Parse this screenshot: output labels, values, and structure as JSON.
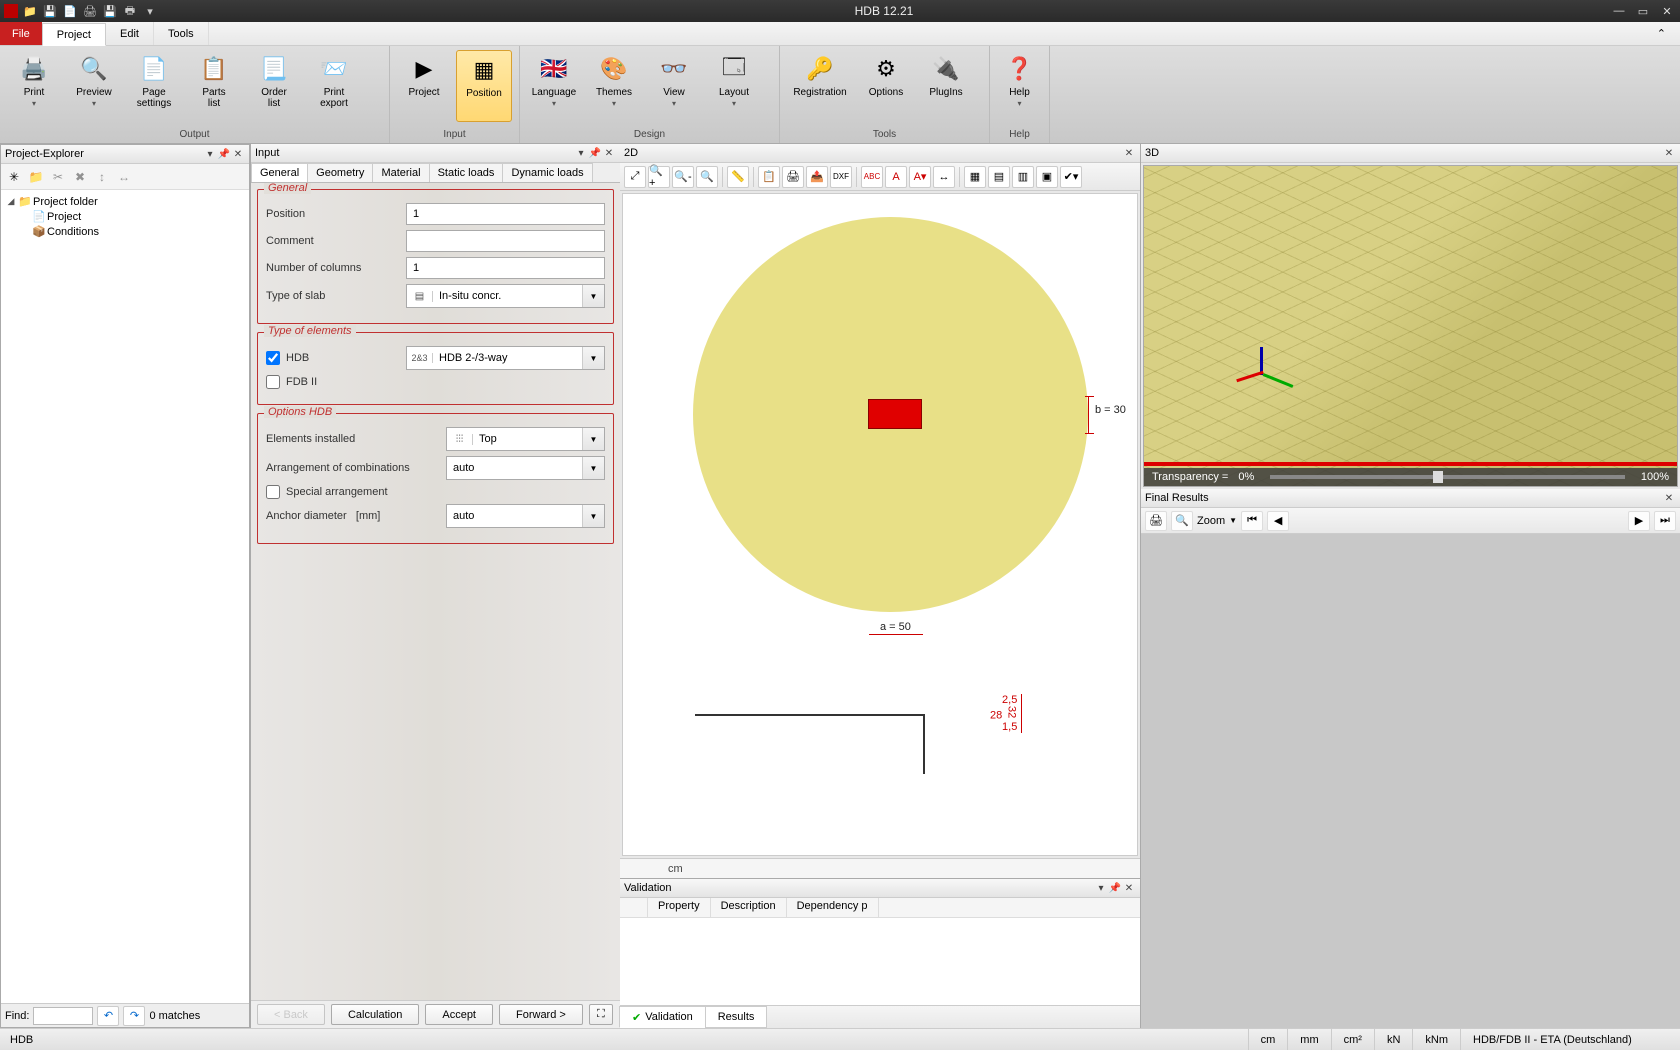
{
  "title": "HDB 12.21",
  "menubar": {
    "file": "File",
    "tabs": [
      "Project",
      "Edit",
      "Tools"
    ],
    "active": 0
  },
  "ribbon": {
    "groups": [
      {
        "caption": "Output",
        "items": [
          {
            "label": "Print",
            "icon": "🖨️",
            "drop": true
          },
          {
            "label": "Preview",
            "icon": "🔍",
            "drop": true
          },
          {
            "label": "Page\nsettings",
            "icon": "📄"
          },
          {
            "label": "Parts\nlist",
            "icon": "📋"
          },
          {
            "label": "Order\nlist",
            "icon": "📃"
          },
          {
            "label": "Print\nexport",
            "icon": "📨"
          }
        ]
      },
      {
        "caption": "Input",
        "items": [
          {
            "label": "Project",
            "icon": "▶"
          },
          {
            "label": "Position",
            "icon": "▦",
            "active": true
          }
        ]
      },
      {
        "caption": "Design",
        "items": [
          {
            "label": "Language",
            "icon": "🇬🇧",
            "drop": true
          },
          {
            "label": "Themes",
            "icon": "🎨",
            "drop": true
          },
          {
            "label": "View",
            "icon": "👓",
            "drop": true
          },
          {
            "label": "Layout",
            "icon": "🗔",
            "drop": true
          }
        ]
      },
      {
        "caption": "Tools",
        "items": [
          {
            "label": "Registration",
            "icon": "🔑"
          },
          {
            "label": "Options",
            "icon": "⚙"
          },
          {
            "label": "PlugIns",
            "icon": "🔌"
          }
        ]
      },
      {
        "caption": "Help",
        "items": [
          {
            "label": "Help",
            "icon": "❓",
            "drop": true
          }
        ]
      }
    ]
  },
  "projectExplorer": {
    "title": "Project-Explorer",
    "root": "Project folder",
    "children": [
      {
        "label": "Project",
        "icon": "📄"
      },
      {
        "label": "Conditions",
        "icon": "📦"
      }
    ]
  },
  "find": {
    "label": "Find:",
    "matches": "0 matches"
  },
  "inputPanel": {
    "title": "Input",
    "tabs": [
      "General",
      "Geometry",
      "Material",
      "Static loads",
      "Dynamic loads"
    ],
    "activeTab": 0,
    "general": {
      "legend": "General",
      "position_lbl": "Position",
      "position": "1",
      "comment_lbl": "Comment",
      "comment": "",
      "numcols_lbl": "Number of columns",
      "numcols": "1",
      "slab_lbl": "Type of slab",
      "slab": "In-situ concr."
    },
    "elements": {
      "legend": "Type of elements",
      "hdb_lbl": "HDB",
      "hdb_checked": true,
      "hdb_type": "HDB 2-/3-way",
      "hdb_prefix": "2&3",
      "fdb_lbl": "FDB II",
      "fdb_checked": false
    },
    "options": {
      "legend": "Options HDB",
      "installed_lbl": "Elements installed",
      "installed": "Top",
      "installed_icon": "⫶⫶⫶",
      "arrange_lbl": "Arrangement of combinations",
      "arrange": "auto",
      "special_lbl": "Special arrangement",
      "special_checked": false,
      "anchor_lbl": "Anchor diameter",
      "anchor_unit": "[mm]",
      "anchor": "auto"
    },
    "nav": {
      "back": "< Back",
      "calc": "Calculation",
      "accept": "Accept",
      "forward": "Forward >"
    }
  },
  "view2d": {
    "title": "2D",
    "unit": "cm",
    "dims": {
      "a": "a = 50",
      "b": "b = 30",
      "s1": "2,5",
      "s2": "28",
      "s3": "32",
      "s4": "1,5"
    }
  },
  "view3d": {
    "title": "3D",
    "transparency_lbl": "Transparency =",
    "transparency_min": "0%",
    "transparency_max": "100%"
  },
  "finalResults": {
    "title": "Final Results",
    "zoom": "Zoom"
  },
  "validation": {
    "title": "Validation",
    "cols": [
      "Property",
      "Description",
      "Dependency p"
    ],
    "tabs": {
      "validation": "Validation",
      "results": "Results"
    }
  },
  "statusbar": {
    "left": "HDB",
    "units": [
      "cm",
      "mm",
      "cm²",
      "kN",
      "kNm"
    ],
    "right": "HDB/FDB II - ETA (Deutschland)"
  }
}
